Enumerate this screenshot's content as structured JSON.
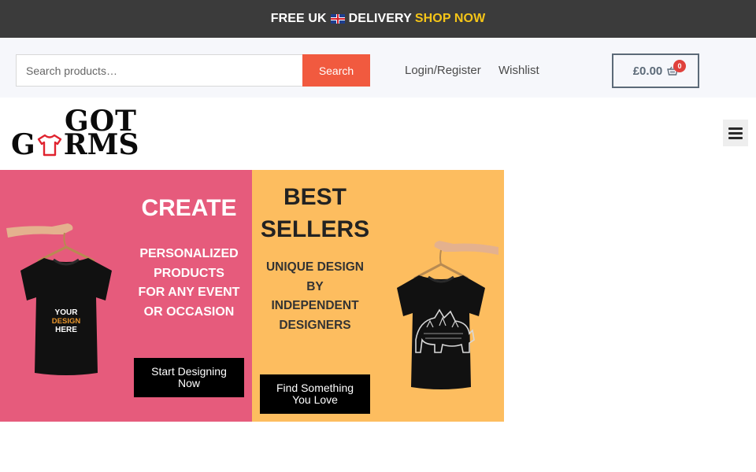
{
  "promo_bar": {
    "text_before_flag": "FREE UK",
    "flag_icon": "uk-flag-icon",
    "text_after_flag": "DELIVERY",
    "shop_now_label": "SHOP NOW",
    "background": "#3b3b3b",
    "accent": "#f5c518"
  },
  "header": {
    "search": {
      "placeholder": "Search products…",
      "value": "",
      "button_label": "Search",
      "button_color": "#f15a3f"
    },
    "nav": {
      "login_label": "Login/Register",
      "wishlist_label": "Wishlist"
    },
    "cart": {
      "total": "£0.00",
      "count": "0",
      "icon": "basket-icon"
    }
  },
  "logo": {
    "line1": "GOT",
    "line2_before": "G",
    "line2_after": "RMS",
    "tee_icon": "tshirt-icon"
  },
  "menu": {
    "icon": "hamburger-menu-icon"
  },
  "panels": {
    "create": {
      "title": "CREATE",
      "desc_lines": [
        "PERSONALIZED",
        "PRODUCTS",
        "FOR ANY EVENT",
        "OR OCCASION"
      ],
      "cta_label": "Start Designing Now",
      "tee_text_lines": [
        "YOUR",
        "DESIGN",
        "HERE"
      ],
      "background": "#e65b7c"
    },
    "best": {
      "title_lines": [
        "BEST",
        "SELLERS"
      ],
      "desc_lines": [
        "UNIQUE DESIGN",
        "BY",
        "INDEPENDENT",
        "DESIGNERS"
      ],
      "cta_label": "Find Something You Love",
      "background": "#fdbd5f"
    }
  }
}
